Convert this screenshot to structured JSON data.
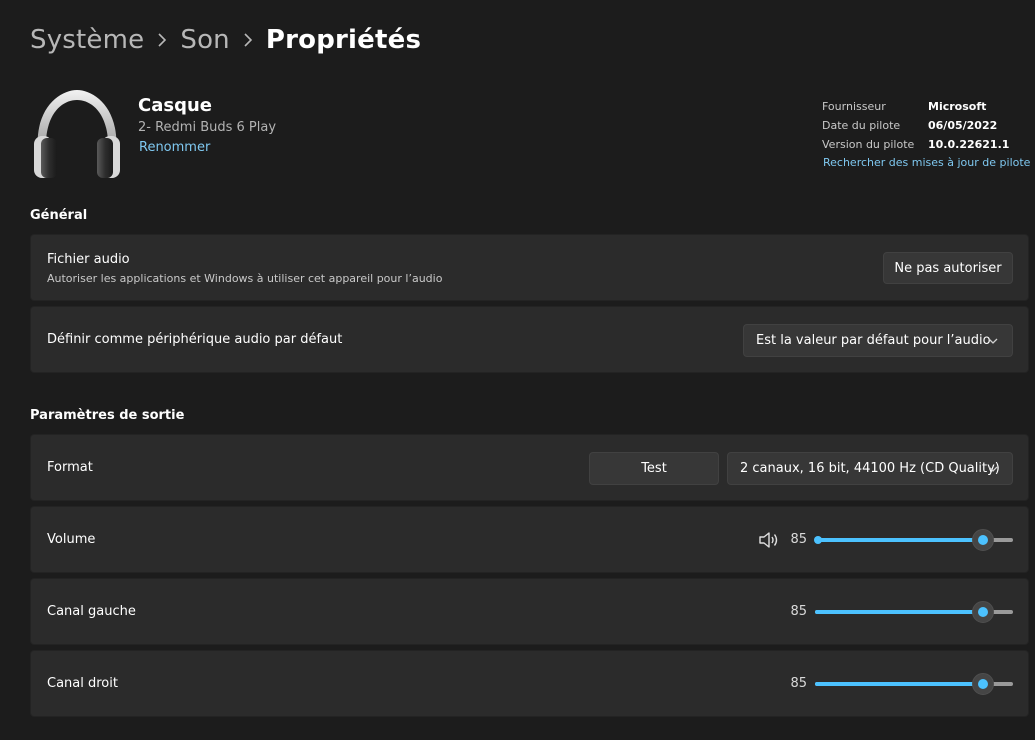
{
  "breadcrumb": [
    "Système",
    "Son",
    "Propriétés"
  ],
  "device": {
    "icon": "headphones-icon",
    "name": "Casque",
    "subtitle": "2- Redmi Buds 6 Play",
    "rename_label": "Renommer"
  },
  "driver": {
    "provider_label": "Fournisseur",
    "provider_value": "Microsoft",
    "date_label": "Date du pilote",
    "date_value": "06/05/2022",
    "version_label": "Version du pilote",
    "version_value": "10.0.22621.1",
    "update_link": "Rechercher des mises à jour de pilote"
  },
  "general": {
    "title": "Général",
    "audio_file": {
      "label": "Fichier audio",
      "description": "Autoriser les applications et Windows à utiliser cet appareil pour l’audio",
      "button": "Ne pas autoriser"
    },
    "default_device": {
      "label": "Définir comme périphérique audio par défaut",
      "selected": "Est la valeur par défaut pour l’audio"
    }
  },
  "output": {
    "title": "Paramètres de sortie",
    "format": {
      "label": "Format",
      "test_button": "Test",
      "selected": "2 canaux, 16 bit, 44100 Hz (CD Quality)"
    },
    "volume": {
      "label": "Volume",
      "value": 85,
      "icon": "speaker-icon"
    },
    "left_channel": {
      "label": "Canal gauche",
      "value": 85
    },
    "right_channel": {
      "label": "Canal droit",
      "value": 85
    }
  },
  "colors": {
    "background": "#1c1c1c",
    "card": "#2b2b2b",
    "accent": "#4cc2ff",
    "link": "#7fc8f0"
  }
}
